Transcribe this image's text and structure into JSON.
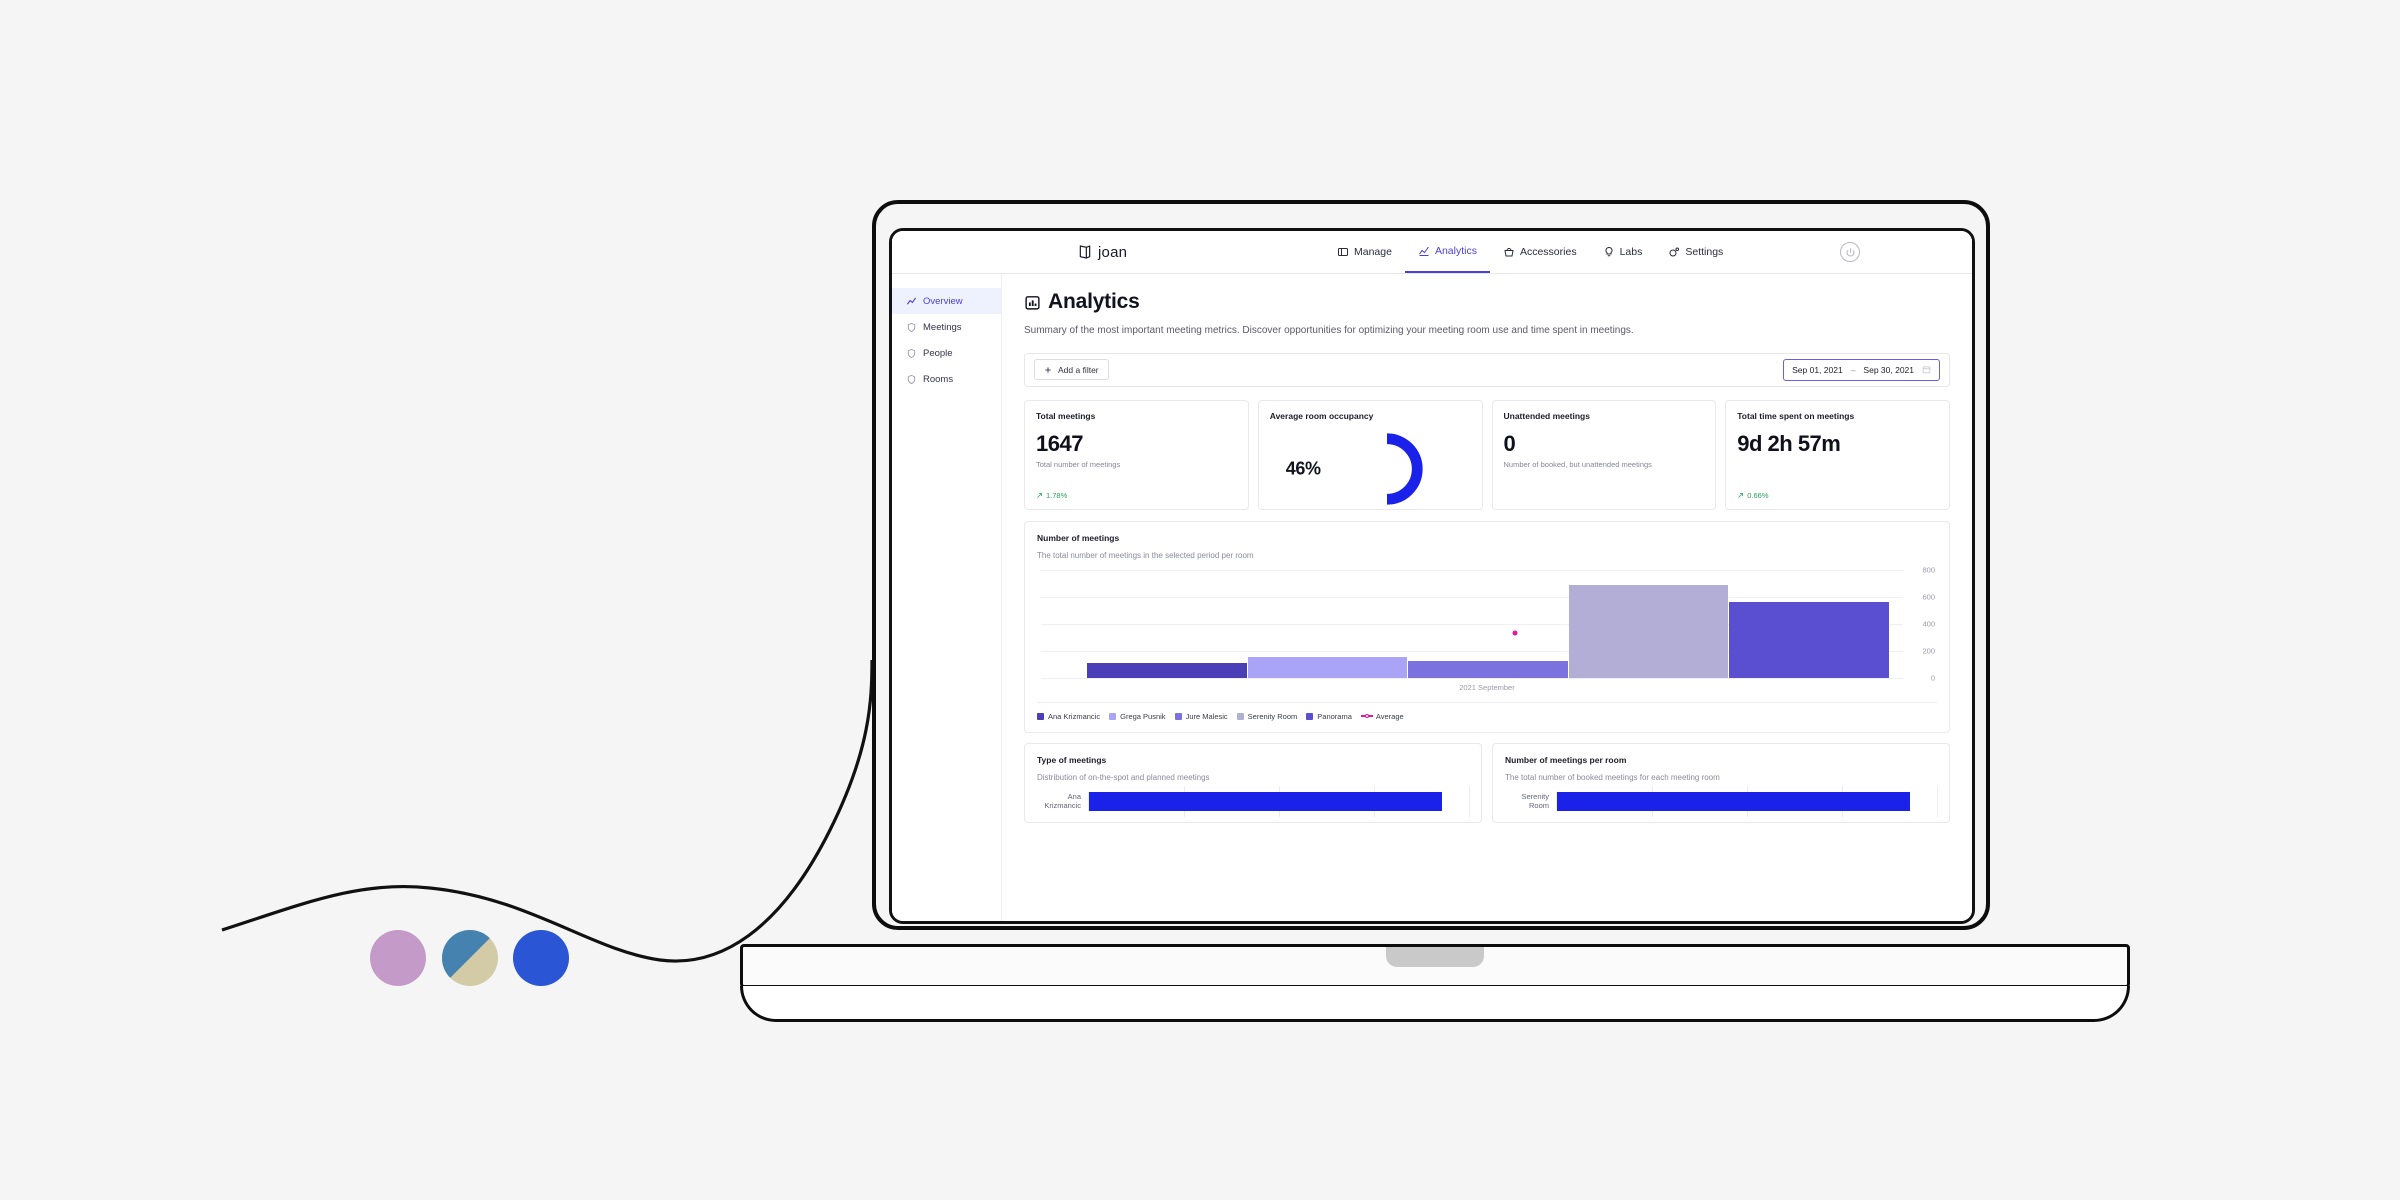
{
  "brand": {
    "name": "joan",
    "accent": "#4b40d6",
    "bar_blue": "#1a21e8",
    "positive": "#2aa35c",
    "avg_pink": "#e3189b"
  },
  "nav": {
    "items": [
      {
        "label": "Manage",
        "icon": "window-icon",
        "active": false
      },
      {
        "label": "Analytics",
        "icon": "line-chart-icon",
        "active": true
      },
      {
        "label": "Accessories",
        "icon": "basket-icon",
        "active": false
      },
      {
        "label": "Labs",
        "icon": "lightbulb-icon",
        "active": false
      },
      {
        "label": "Settings",
        "icon": "gear-icon",
        "active": false
      }
    ],
    "avatar": "power-avatar-icon"
  },
  "sidebar": {
    "items": [
      {
        "label": "Overview",
        "icon": "line-chart-icon",
        "active": true
      },
      {
        "label": "Meetings",
        "icon": "shield-icon",
        "active": false
      },
      {
        "label": "People",
        "icon": "shield-icon",
        "active": false
      },
      {
        "label": "Rooms",
        "icon": "shield-icon",
        "active": false
      }
    ]
  },
  "page": {
    "title": "Analytics",
    "title_icon": "bar-chart-icon",
    "description": "Summary of the most important meeting metrics. Discover opportunities for optimizing your meeting room use and time spent in meetings."
  },
  "filters": {
    "add_filter_label": "Add a filter",
    "date_from": "Sep 01, 2021",
    "date_separator": "–",
    "date_to": "Sep 30, 2021",
    "calendar_icon": "calendar-icon"
  },
  "cards": [
    {
      "title": "Total meetings",
      "value": "1647",
      "subtitle": "Total number of meetings",
      "delta": "1.78%",
      "delta_icon": "arrow-up-right-icon",
      "type": "value"
    },
    {
      "title": "Average room occupancy",
      "value": "46%",
      "subtitle": "",
      "delta": "",
      "type": "donut",
      "percent": 46
    },
    {
      "title": "Unattended meetings",
      "value": "0",
      "subtitle": "Number of booked, but unattended meetings",
      "delta": "",
      "type": "value"
    },
    {
      "title": "Total time spent on meetings",
      "value": "9d 2h 57m",
      "subtitle": "",
      "delta": "0.66%",
      "delta_icon": "arrow-up-right-icon",
      "type": "value"
    }
  ],
  "meetings_panel": {
    "title": "Number of meetings",
    "subtitle": "The total number of meetings in the selected period per room"
  },
  "type_panel": {
    "title": "Type of meetings",
    "subtitle": "Distribution of on-the-spot and planned meetings",
    "row_label": "Ana\nKrizmancic",
    "row_fill_pct": 93
  },
  "per_room_panel": {
    "title": "Number of meetings per room",
    "subtitle": "The total number of booked meetings for each meeting room",
    "row_label": "Serenity\nRoom",
    "row_fill_pct": 93
  },
  "chart_data": {
    "type": "bar",
    "title": "Number of meetings",
    "subtitle": "The total number of meetings in the selected period per room",
    "xlabel": "2021 September",
    "ylabel": "",
    "categories": [
      "Ana Krizmancic",
      "Grega Pusnik",
      "Jure Malesic",
      "Serenity Room",
      "Panorama"
    ],
    "values": [
      110,
      150,
      125,
      685,
      560
    ],
    "colors": [
      "#4b3fb8",
      "#a9a4f5",
      "#7b72e0",
      "#b3aed6",
      "#5a4fd0"
    ],
    "ylim": [
      0,
      800
    ],
    "yticks": [
      0,
      200,
      400,
      600,
      800
    ],
    "grid": true,
    "legend_position": "bottom",
    "legend": [
      {
        "name": "Ana Krizmancic",
        "color": "#4b3fb8"
      },
      {
        "name": "Grega Pusnik",
        "color": "#a9a4f5"
      },
      {
        "name": "Jure Malesic",
        "color": "#7b72e0"
      },
      {
        "name": "Serenity Room",
        "color": "#b3aed6"
      },
      {
        "name": "Panorama",
        "color": "#5a4fd0"
      }
    ],
    "average_series": {
      "name": "Average",
      "value": 330,
      "color": "#e3189b",
      "marker": "dot"
    }
  },
  "decor": {
    "circles": [
      {
        "name": "mauve-circle",
        "color": "#c49ac9"
      },
      {
        "name": "split-circle",
        "color_left": "#4682b0",
        "color_right": "#d3cba6"
      },
      {
        "name": "blue-circle",
        "color": "#2a55d4"
      }
    ],
    "cable": "curved-cable-line"
  }
}
